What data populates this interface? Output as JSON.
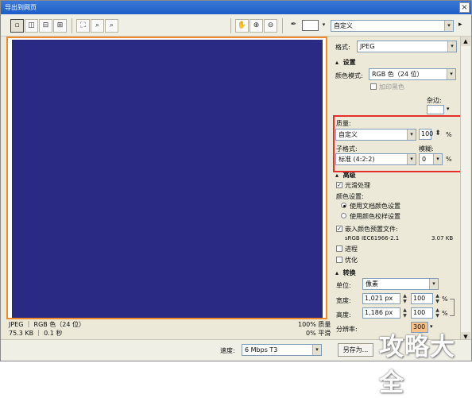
{
  "window": {
    "title": "导出到网页",
    "close": "×"
  },
  "toolbar": {
    "view_icons": [
      "layout-1-icon",
      "layout-2-icon",
      "layout-3-icon",
      "layout-4-icon"
    ],
    "zoom_icons": [
      "fit-icon",
      "zoom-100-icon",
      "zoom-fit-icon"
    ],
    "tool_icons": [
      "hand-icon",
      "zoom-in-icon",
      "zoom-out-icon",
      "eyedropper-icon"
    ],
    "preset_value": "自定义",
    "preset_arrow": "▾",
    "more_arrow": "▸"
  },
  "canvas": {
    "fill": "#2a2984",
    "border": "#ee8a2a"
  },
  "panel": {
    "format_label": "格式:",
    "format_value": "JPEG",
    "settings_section": "设置",
    "colormode_label": "颜色模式:",
    "colormode_value": "RGB 色（24 位）",
    "add_black_label": "加印黑色",
    "matte_label": "杂边:",
    "quality_label": "质量:",
    "quality_preset": "自定义",
    "quality_value": "100",
    "quality_unit": "%",
    "subformat_label": "子格式:",
    "subformat_value": "标准 (4:2:2)",
    "blur_label": "模糊:",
    "blur_value": "0",
    "blur_unit": "%",
    "advanced_section": "高级",
    "smooth_label": "光滑处理",
    "smooth_checked": "✓",
    "colorset_label": "颜色设置:",
    "use_doc_color": "使用文档颜色设置",
    "use_proof_color": "使用颜色校样设置",
    "embed_profile_label": "嵌入颜色预置文件:",
    "embed_checked": "✓",
    "profile_name": "sRGB IEC61966-2.1",
    "profile_size": "3.07 KB",
    "progressive_label": "进程",
    "optimize_label": "优化",
    "transform_section": "转换",
    "unit_label": "单位:",
    "unit_value": "像素",
    "width_label": "宽度:",
    "width_value": "1,021 px",
    "width_pct": "100",
    "height_label": "高度:",
    "height_value": "1,186 px",
    "height_pct": "100",
    "pct_unit": "%",
    "resolution_label": "分辨率:",
    "resolution_value": "300"
  },
  "status": {
    "format_info": "JPEG ｜ RGB 色（24 位）",
    "size_info": "75.3 KB ｜ 0.1 秒",
    "quality_info": "100% 质量",
    "smooth_info": "0% 平滑",
    "speed_label": "速度:",
    "speed_value": "6 Mbps T3",
    "save_button": "另存为..."
  },
  "watermark": "攻略大全"
}
